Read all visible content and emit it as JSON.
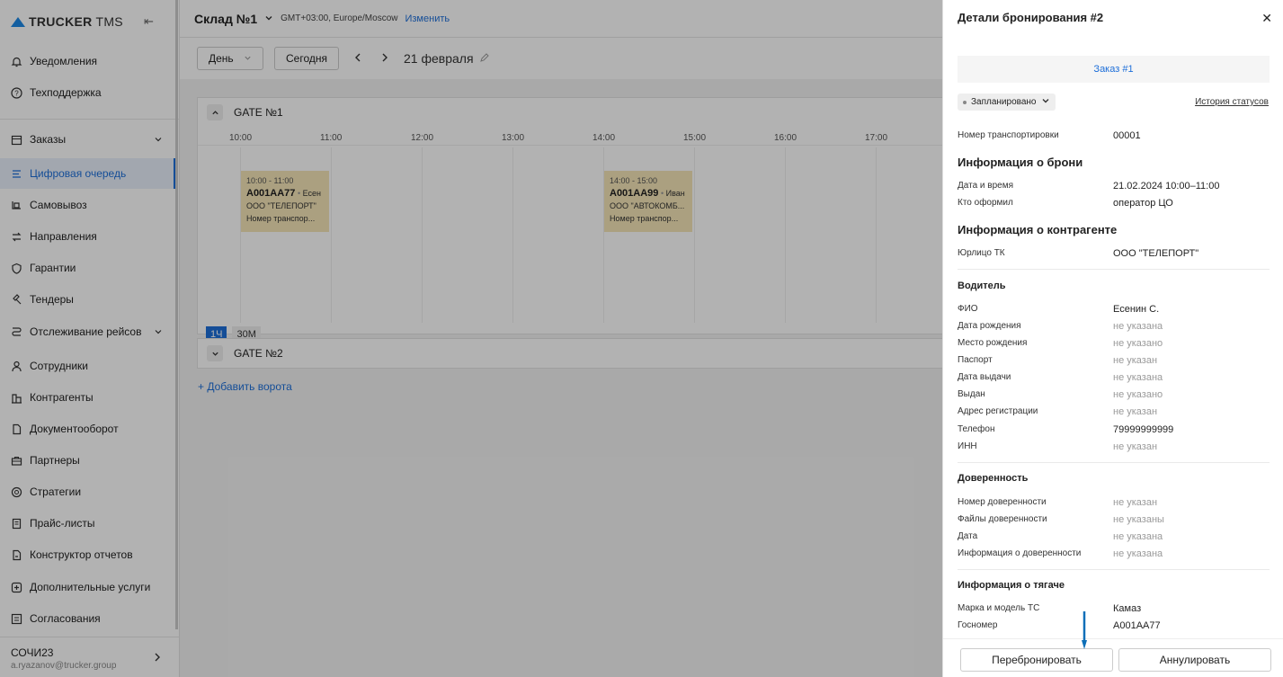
{
  "sidebar": {
    "logo": {
      "bold": "TRUCKER",
      "rest": " TMS"
    },
    "items": [
      {
        "label": "Уведомления",
        "icon": "bell-icon"
      },
      {
        "label": "Техподдержка",
        "icon": "help-icon"
      },
      {
        "label": "Заказы",
        "icon": "orders-icon"
      },
      {
        "label": "Цифровая очередь",
        "icon": "queue-icon"
      },
      {
        "label": "Самовывоз",
        "icon": "pickup-icon"
      },
      {
        "label": "Направления",
        "icon": "directions-icon"
      },
      {
        "label": "Гарантии",
        "icon": "shield-icon"
      },
      {
        "label": "Тендеры",
        "icon": "gavel-icon"
      },
      {
        "label": "Отслеживание рейсов",
        "icon": "route-icon"
      },
      {
        "label": "Сотрудники",
        "icon": "person-icon"
      },
      {
        "label": "Контрагенты",
        "icon": "building-icon"
      },
      {
        "label": "Документооборот",
        "icon": "document-icon"
      },
      {
        "label": "Партнеры",
        "icon": "briefcase-icon"
      },
      {
        "label": "Стратегии",
        "icon": "strategy-icon"
      },
      {
        "label": "Прайс-листы",
        "icon": "pricelist-icon"
      },
      {
        "label": "Конструктор отчетов",
        "icon": "report-icon"
      },
      {
        "label": "Дополнительные услуги",
        "icon": "plus-box-icon"
      },
      {
        "label": "Согласования",
        "icon": "approval-icon"
      }
    ],
    "user": {
      "name": "СОЧИ23",
      "email": "a.ryazanov@trucker.group"
    }
  },
  "topbar": {
    "warehouse": "Склад №1",
    "timezone": "GMT+03:00, Europe/Moscow",
    "change_link": "Изменить"
  },
  "toolbar": {
    "view": "День",
    "today": "Сегодня",
    "date": "21 февраля"
  },
  "schedule": {
    "gate1": "GATE №1",
    "gate2": "GATE №2",
    "hours": [
      "10:00",
      "11:00",
      "12:00",
      "13:00",
      "14:00",
      "15:00",
      "16:00",
      "17:00"
    ],
    "bookings": [
      {
        "time": "10:00 - 11:00",
        "plate": "А001АА77",
        "driver": "Есен",
        "company": "ООО \"ТЕЛЕПОРТ\"",
        "note": "Номер транспор..."
      },
      {
        "time": "14:00 - 15:00",
        "plate": "А001АА99",
        "driver": "Иван",
        "company": "ООО \"АВТОКОМБ...",
        "note": "Номер транспор..."
      }
    ],
    "zoom_1h": "1Ч",
    "zoom_30m": "30М",
    "add_gate": "Добавить ворота"
  },
  "panel": {
    "title": "Детали бронирования #2",
    "order_link": "Заказ #1",
    "status": "Запланировано",
    "history_link": "История статусов",
    "transport_no_label": "Номер транспортировки",
    "transport_no": "00001",
    "booking_section": "Информация о брони",
    "datetime_label": "Дата и время",
    "datetime": "21.02.2024 10:00–11:00",
    "created_by_label": "Кто оформил",
    "created_by": "оператор ЦО",
    "contractor_section": "Информация о контрагенте",
    "legal_label": "Юрлицо ТК",
    "legal": "ООО \"ТЕЛЕПОРТ\"",
    "driver_section": "Водитель",
    "driver_rows": [
      {
        "k": "ФИО",
        "v": "Есенин С.",
        "muted": false
      },
      {
        "k": "Дата рождения",
        "v": "не указана",
        "muted": true
      },
      {
        "k": "Место рождения",
        "v": "не указано",
        "muted": true
      },
      {
        "k": "Паспорт",
        "v": "не указан",
        "muted": true
      },
      {
        "k": "Дата выдачи",
        "v": "не указана",
        "muted": true
      },
      {
        "k": "Выдан",
        "v": "не указано",
        "muted": true
      },
      {
        "k": "Адрес регистрации",
        "v": "не указан",
        "muted": true
      },
      {
        "k": "Телефон",
        "v": "79999999999",
        "muted": false
      },
      {
        "k": "ИНН",
        "v": "не указан",
        "muted": true
      }
    ],
    "poa_section": "Доверенность",
    "poa_rows": [
      {
        "k": "Номер доверенности",
        "v": "не указан",
        "muted": true
      },
      {
        "k": "Файлы доверенности",
        "v": "не указаны",
        "muted": true
      },
      {
        "k": "Дата",
        "v": "не указана",
        "muted": true
      },
      {
        "k": "Информация о доверенности",
        "v": "не указана",
        "muted": true
      }
    ],
    "tractor_section": "Информация о тягаче",
    "tractor_rows": [
      {
        "k": "Марка и модель ТС",
        "v": "Камаз",
        "muted": false
      },
      {
        "k": "Госномер",
        "v": "А001АА77",
        "muted": false
      }
    ],
    "rebook_button": "Перебронировать",
    "cancel_button": "Аннулировать"
  },
  "colors": {
    "accent": "#1e6fd9",
    "booking": "#f5e6b8",
    "annotation_arrow": "#0d6fb8"
  }
}
